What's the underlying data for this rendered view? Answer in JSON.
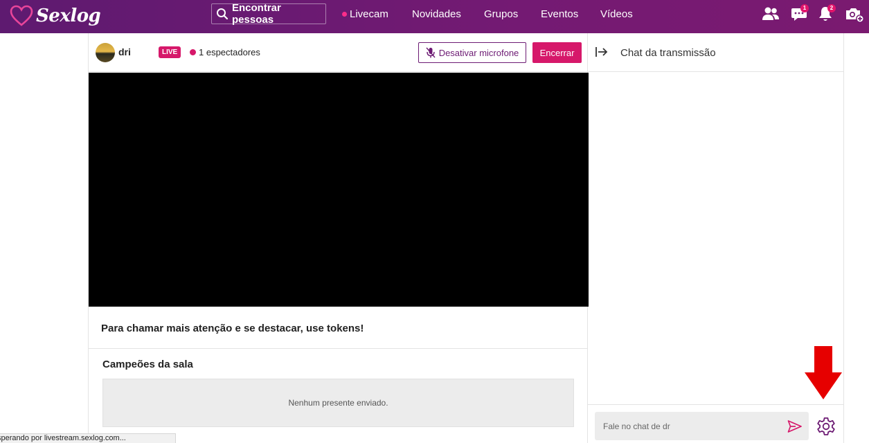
{
  "brand": {
    "name": "Sexlog"
  },
  "nav": {
    "search_label": "Encontrar pessoas",
    "items": [
      "Livecam",
      "Novidades",
      "Grupos",
      "Eventos",
      "Vídeos"
    ],
    "messages_badge": "1",
    "notifications_badge": "2"
  },
  "stream": {
    "username": "dri",
    "live_label": "LIVE",
    "viewers": "1 espectadores",
    "mic_button": "Desativar microfone",
    "end_button": "Encerrar"
  },
  "tokens_message": "Para chamar mais atenção e se destacar, use tokens!",
  "champions": {
    "title": "Campeões da sala",
    "empty": "Nenhum presente enviado."
  },
  "chat": {
    "title": "Chat da transmissão",
    "placeholder": "Fale no chat de dr"
  },
  "status_bar": "sperando por livestream.sexlog.com...",
  "colors": {
    "brand_purple": "#6c1a73",
    "accent_pink": "#d6186a",
    "annotation_red": "#e60000"
  }
}
